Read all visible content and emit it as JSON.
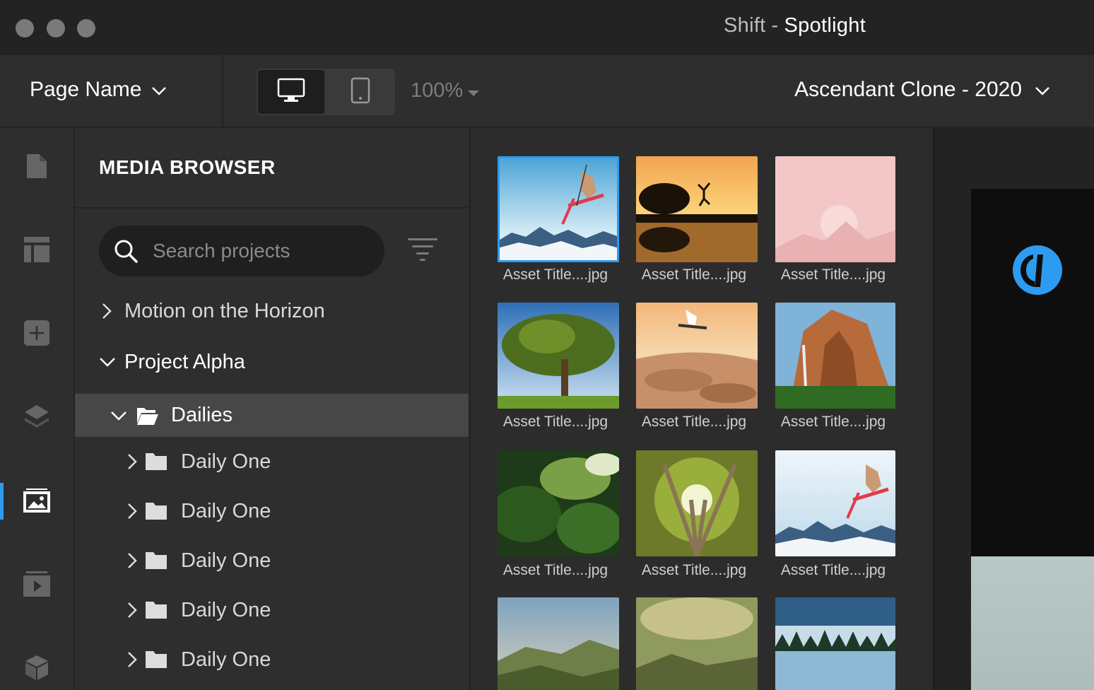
{
  "window": {
    "app_name": "Shift",
    "separator": "-",
    "document_name": "Spotlight"
  },
  "toolbar": {
    "page_name": "Page Name",
    "zoom": "100%",
    "project": "Ascendant Clone - 2020",
    "devices": [
      "desktop-icon",
      "tablet-icon"
    ],
    "active_device": "desktop"
  },
  "rail": {
    "items": [
      "page-icon",
      "layout-icon",
      "add-icon",
      "layers-icon",
      "media-icon",
      "video-icon",
      "cube-icon"
    ],
    "active": "media-icon",
    "accent_color": "#2d9bf0"
  },
  "browser": {
    "title": "MEDIA BROWSER",
    "search_placeholder": "Search projects",
    "tree": {
      "collapsed_project": "Motion on the Horizon",
      "expanded_project": "Project Alpha",
      "selected_folder": "Dailies",
      "children": [
        "Daily One",
        "Daily One",
        "Daily One",
        "Daily One",
        "Daily One"
      ]
    }
  },
  "assets": [
    {
      "title": "Asset Title....jpg",
      "selected": true
    },
    {
      "title": "Asset Title....jpg"
    },
    {
      "title": "Asset Title....jpg"
    },
    {
      "title": "Asset Title....jpg"
    },
    {
      "title": "Asset Title....jpg"
    },
    {
      "title": "Asset Title....jpg"
    },
    {
      "title": "Asset Title....jpg"
    },
    {
      "title": "Asset Title....jpg"
    },
    {
      "title": "Asset Title....jpg"
    },
    {
      "title": ""
    },
    {
      "title": ""
    },
    {
      "title": ""
    }
  ]
}
